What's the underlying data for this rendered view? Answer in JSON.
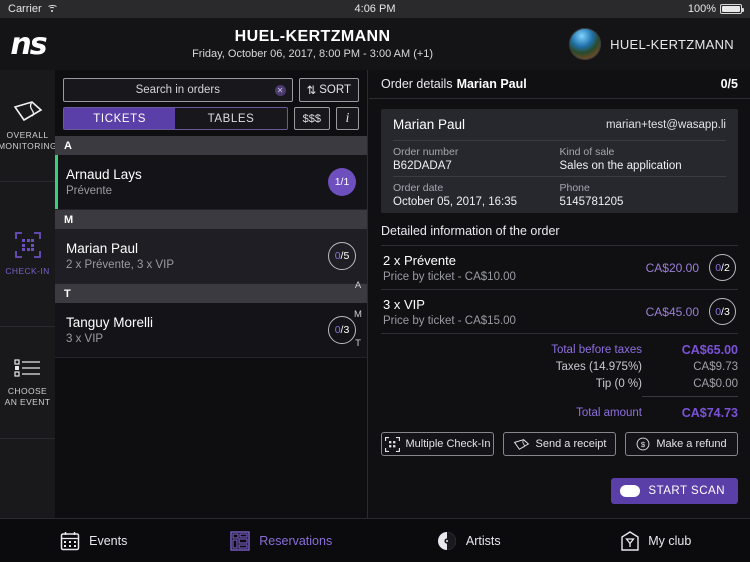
{
  "statusbar": {
    "carrier": "Carrier",
    "time": "4:06 PM",
    "battery": "100%",
    "wifi_icon": "wifi-icon",
    "battery_icon": "battery-icon"
  },
  "header": {
    "logo": "ns",
    "title": "HUEL-KERTZMANN",
    "subtitle": "Friday, October 06, 2017, 8:00 PM - 3:00 AM (+1)",
    "club_name": "HUEL-KERTZMANN",
    "avatar_icon": "club-avatar"
  },
  "rail": {
    "items": [
      {
        "label": "OVERALL MONITORING",
        "icon": "ticket-icon",
        "active": false
      },
      {
        "label": "CHECK-IN",
        "icon": "qr-scan-icon",
        "active": true
      },
      {
        "label": "CHOOSE AN EVENT",
        "icon": "list-icon",
        "active": false
      }
    ]
  },
  "list": {
    "search": {
      "placeholder": "Search in orders",
      "value": "",
      "clear_icon": "clear-icon"
    },
    "sort_label": "SORT",
    "sort_icon": "sort-arrows-icon",
    "tabs": [
      {
        "label": "TICKETS",
        "active": true
      },
      {
        "label": "TABLES",
        "active": false
      }
    ],
    "money_button": "$$$",
    "info_button": "i",
    "alpha_index": [
      "A",
      "M",
      "T"
    ],
    "groups": [
      {
        "letter": "A",
        "rows": [
          {
            "name": "Arnaud Lays",
            "sub": "Prévente",
            "count": "1/1",
            "checked": "1",
            "total": "/1",
            "badge": "filled",
            "accent": "#3ad07a",
            "selected": false
          }
        ]
      },
      {
        "letter": "M",
        "rows": [
          {
            "name": "Marian Paul",
            "sub": "2 x Prévente, 3 x VIP",
            "count": "0/5",
            "checked": "0",
            "total": "/5",
            "badge": "hollow",
            "accent": "",
            "selected": true
          }
        ]
      },
      {
        "letter": "T",
        "rows": [
          {
            "name": "Tanguy Morelli",
            "sub": "3 x VIP",
            "count": "0/3",
            "checked": "0",
            "total": "/3",
            "badge": "hollow",
            "accent": "",
            "selected": false
          }
        ]
      }
    ]
  },
  "detail": {
    "header_prefix": "Order details",
    "header_name": "Marian Paul",
    "header_count": "0/5",
    "customer": {
      "name": "Marian Paul",
      "email": "marian+test@wasapp.li",
      "fields": [
        {
          "label": "Order number",
          "value": "B62DADA7"
        },
        {
          "label": "Kind of sale",
          "value": "Sales on the application"
        },
        {
          "label": "Order date",
          "value": "October 05, 2017, 16:35"
        },
        {
          "label": "Phone",
          "value": "5145781205"
        }
      ]
    },
    "section_title": "Detailed information of the order",
    "line_items": [
      {
        "title": "2 x Prévente",
        "sub": "Price by ticket - CA$10.00",
        "price": "CA$20.00",
        "checked": "0",
        "total": "/2"
      },
      {
        "title": "3 x VIP",
        "sub": "Price by ticket - CA$15.00",
        "price": "CA$45.00",
        "checked": "0",
        "total": "/3"
      }
    ],
    "totals": [
      {
        "label": "Total before taxes",
        "value": "CA$65.00",
        "accent": true
      },
      {
        "label": "Taxes (14.975%)",
        "value": "CA$9.73",
        "accent": false
      },
      {
        "label": "Tip (0 %)",
        "value": "CA$0.00",
        "accent": false
      }
    ],
    "grand_total": {
      "label": "Total amount",
      "value": "CA$74.73"
    },
    "actions": [
      {
        "label": "Multiple Check-In",
        "icon": "qr-scan-icon"
      },
      {
        "label": "Send a receipt",
        "icon": "ticket-icon"
      },
      {
        "label": "Make a refund",
        "icon": "dollar-circle-icon"
      }
    ],
    "scan_button": "START SCAN"
  },
  "tabbar": {
    "items": [
      {
        "label": "Events",
        "icon": "calendar-icon",
        "active": false
      },
      {
        "label": "Reservations",
        "icon": "tables-grid-icon",
        "active": true
      },
      {
        "label": "Artists",
        "icon": "vinyl-icon",
        "active": false
      },
      {
        "label": "My club",
        "icon": "club-house-icon",
        "active": false
      }
    ]
  },
  "colors": {
    "accent_purple": "#5b3fa8",
    "accent_light": "#8e6fe0",
    "green": "#3ad07a",
    "bg": "#101013"
  }
}
